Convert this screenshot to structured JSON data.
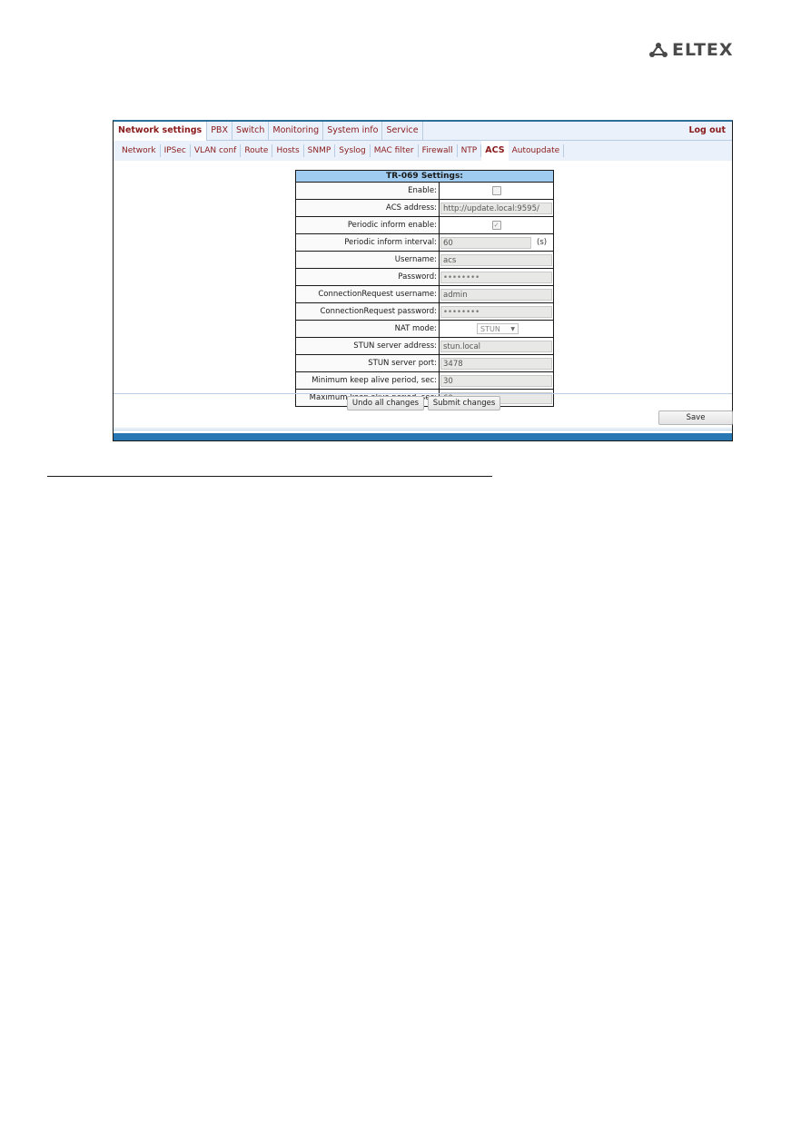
{
  "brand": {
    "logo_text": "ELTEX"
  },
  "top_nav": {
    "tabs": [
      {
        "label": "Network settings",
        "active": true
      },
      {
        "label": "PBX"
      },
      {
        "label": "Switch"
      },
      {
        "label": "Monitoring"
      },
      {
        "label": "System info"
      },
      {
        "label": "Service"
      }
    ],
    "logout": "Log out"
  },
  "sub_nav": {
    "tabs": [
      {
        "label": "Network"
      },
      {
        "label": "IPSec"
      },
      {
        "label": "VLAN conf"
      },
      {
        "label": "Route"
      },
      {
        "label": "Hosts"
      },
      {
        "label": "SNMP"
      },
      {
        "label": "Syslog"
      },
      {
        "label": "MAC filter"
      },
      {
        "label": "Firewall"
      },
      {
        "label": "NTP"
      },
      {
        "label": "ACS",
        "active": true
      },
      {
        "label": "Autoupdate"
      }
    ]
  },
  "settings": {
    "title": "TR-069 Settings:",
    "enable_label": "Enable:",
    "enable_checked": false,
    "acs_address_label": "ACS address:",
    "acs_address": "http://update.local:9595/",
    "periodic_enable_label": "Periodic inform enable:",
    "periodic_enable_checked": true,
    "periodic_interval_label": "Periodic inform interval:",
    "periodic_interval": "60",
    "periodic_interval_unit": "(s)",
    "username_label": "Username:",
    "username": "acs",
    "password_label": "Password:",
    "password": "••••••••",
    "cr_username_label": "ConnectionRequest username:",
    "cr_username": "admin",
    "cr_password_label": "ConnectionRequest password:",
    "cr_password": "••••••••",
    "nat_mode_label": "NAT mode:",
    "nat_mode": "STUN",
    "stun_address_label": "STUN server address:",
    "stun_address": "stun.local",
    "stun_port_label": "STUN server port:",
    "stun_port": "3478",
    "min_keepalive_label": "Minimum keep alive period, sec:",
    "min_keepalive": "30",
    "max_keepalive_label": "Maximum keep alive period, sec:",
    "max_keepalive": "60"
  },
  "actions": {
    "undo": "Undo all changes",
    "submit": "Submit changes",
    "save": "Save"
  },
  "icons": {
    "dropdown": "▼",
    "check": "✓"
  }
}
